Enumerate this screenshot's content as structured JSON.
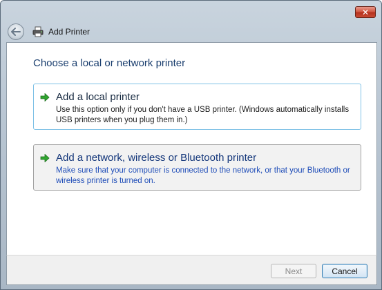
{
  "window": {
    "title": "Add Printer",
    "close_label": "✕"
  },
  "main": {
    "heading": "Choose a local or network printer",
    "options": [
      {
        "title": "Add a local printer",
        "description": "Use this option only if you don't have a USB printer. (Windows automatically installs USB printers when you plug them in.)"
      },
      {
        "title": "Add a network, wireless or Bluetooth printer",
        "description": "Make sure that your computer is connected to the network, or that your Bluetooth or wireless printer is turned on."
      }
    ]
  },
  "footer": {
    "next_label": "Next",
    "cancel_label": "Cancel"
  },
  "colors": {
    "heading": "#1a3e6e",
    "link_blue": "#1f4db8",
    "selected_border": "#7ec1e6",
    "close_red": "#c94a34"
  },
  "icons": {
    "back": "back-arrow-icon",
    "printer": "printer-icon",
    "option_arrow": "green-arrow-icon",
    "close": "close-icon"
  }
}
